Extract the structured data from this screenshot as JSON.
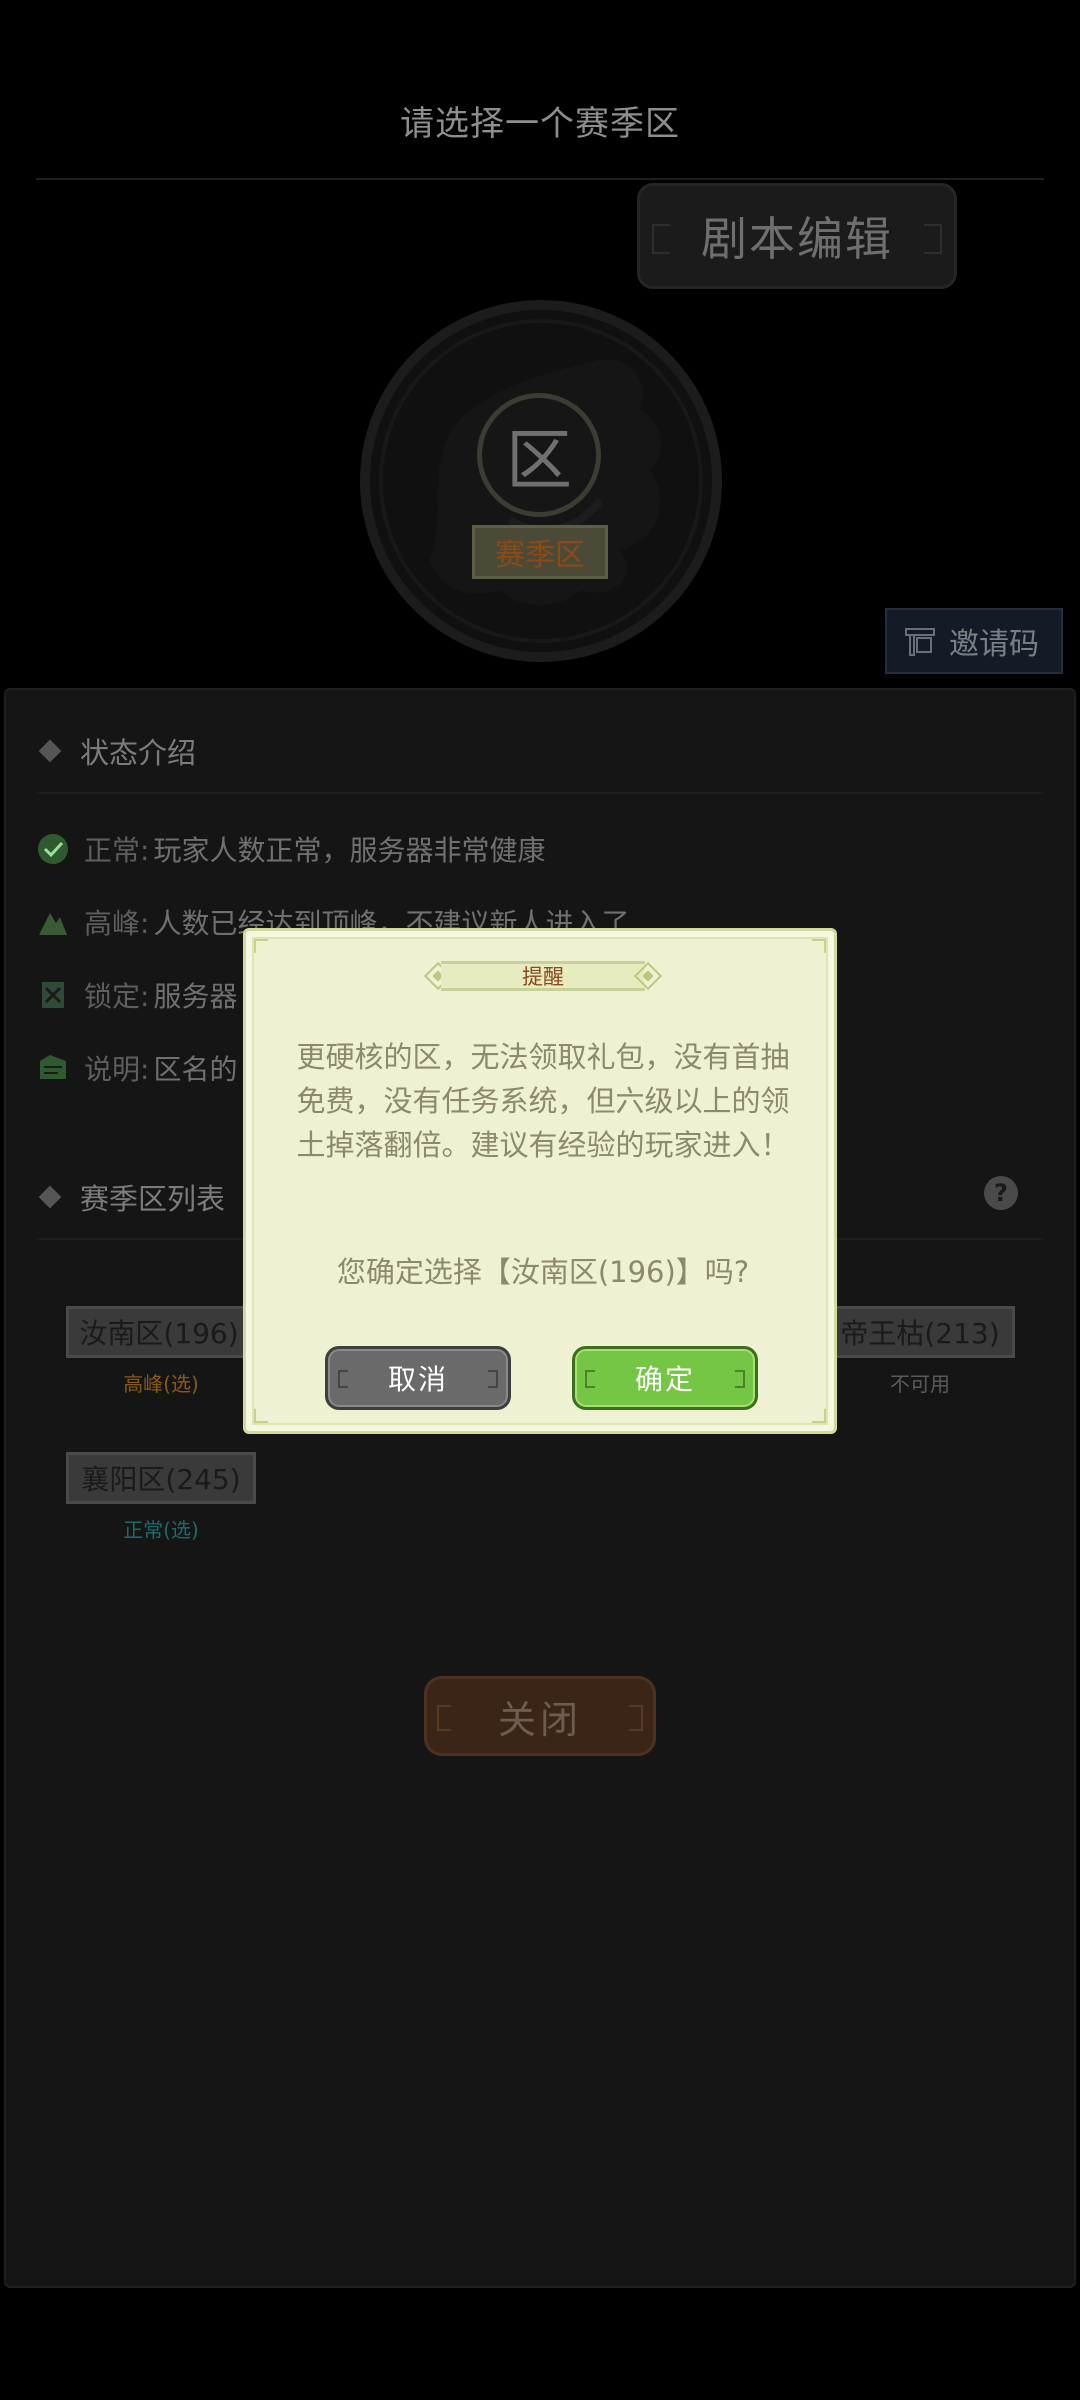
{
  "header": {
    "title": "请选择一个赛季区",
    "script_edit_label": "剧本编辑",
    "zone_icon_char": "区",
    "season_badge": "赛季区",
    "invite_label": "邀请码"
  },
  "status_section": {
    "title": "状态介绍",
    "rows": [
      {
        "key": "正常:",
        "text": "玩家人数正常，服务器非常健康",
        "icon": "check-circle-icon"
      },
      {
        "key": "高峰:",
        "text": "人数已经达到顶峰，不建议新人进入了",
        "icon": "peak-icon"
      },
      {
        "key": "锁定:",
        "text": "服务器",
        "icon": "lock-icon"
      },
      {
        "key": "说明:",
        "text": "区名的",
        "icon": "note-icon"
      }
    ]
  },
  "zone_section": {
    "title": "赛季区列表",
    "zones": [
      {
        "name": "汝南区(196)",
        "state": "高峰(选)",
        "state_color": "#8a5a14"
      },
      {
        "name": "帝王枯(213)",
        "state": "不可用",
        "state_color": "#5a5a5a"
      },
      {
        "name": "襄阳区(245)",
        "state": "正常(选)",
        "state_color": "#1e6a6a"
      }
    ]
  },
  "close_label": "关闭",
  "dialog": {
    "title": "提醒",
    "message": "更硬核的区，无法领取礼包，没有首抽免费，没有任务系统，但六级以上的领土掉落翻倍。建议有经验的玩家进入！",
    "confirm_question": "您确定选择【汝南区(196)】吗?",
    "cancel_label": "取消",
    "confirm_label": "确定"
  },
  "colors": {
    "accent_green": "#76c645",
    "dialog_bg": "#eff2d2",
    "title_brown": "#8b4a1e"
  }
}
